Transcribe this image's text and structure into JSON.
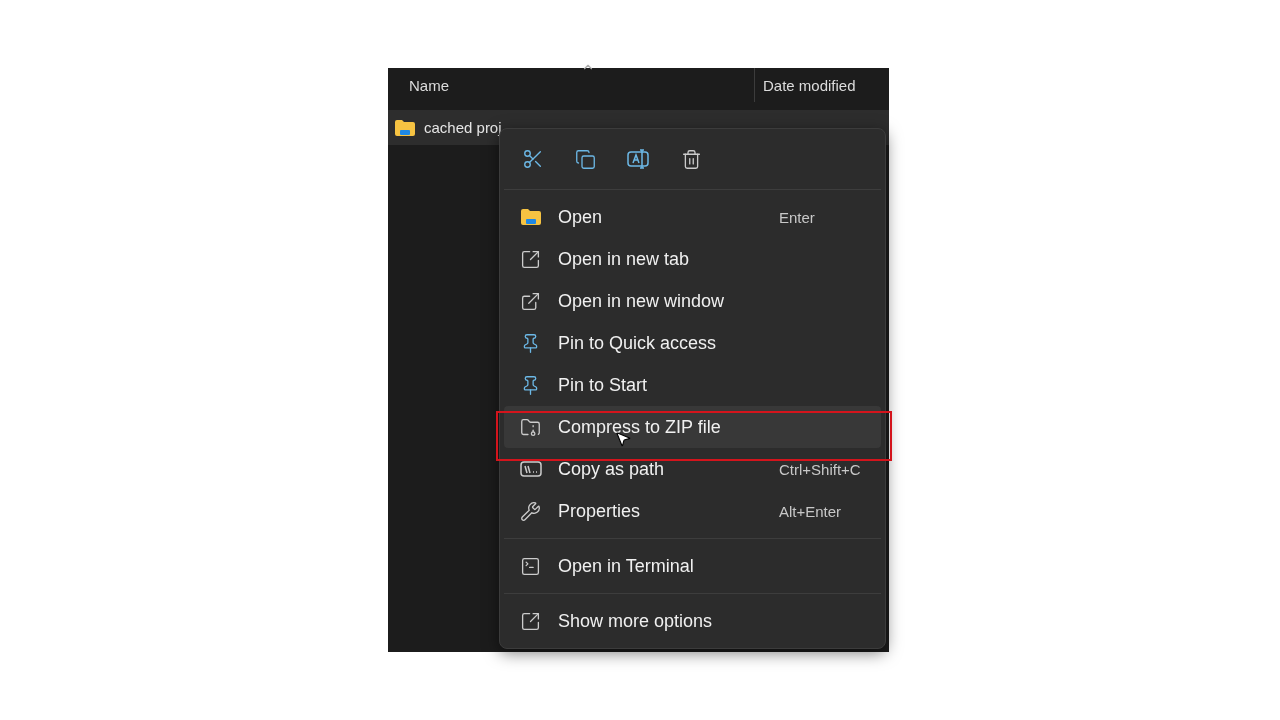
{
  "file_list": {
    "columns": [
      {
        "label": "Name"
      },
      {
        "label": "Date modified"
      }
    ],
    "rows": [
      {
        "name": "cached proj",
        "selected": true
      }
    ]
  },
  "context_menu": {
    "sections": [
      [
        {
          "label": "Open",
          "shortcut": "Enter",
          "hovered": false,
          "annotated": false
        },
        {
          "label": "Open in new tab",
          "hovered": false,
          "annotated": false
        },
        {
          "label": "Open in new window",
          "hovered": false,
          "annotated": false
        },
        {
          "label": "Pin to Quick access",
          "hovered": false,
          "annotated": false
        },
        {
          "label": "Pin to Start",
          "hovered": false,
          "annotated": false
        },
        {
          "label": "Compress to ZIP file",
          "hovered": true,
          "annotated": true
        },
        {
          "label": "Copy as path",
          "shortcut": "Ctrl+Shift+C",
          "hovered": false,
          "annotated": false
        },
        {
          "label": "Properties",
          "shortcut": "Alt+Enter",
          "hovered": false,
          "annotated": false
        }
      ],
      [
        {
          "label": "Open in Terminal",
          "hovered": false,
          "annotated": false
        }
      ],
      [
        {
          "label": "Show more options",
          "hovered": false,
          "annotated": false
        }
      ]
    ]
  }
}
